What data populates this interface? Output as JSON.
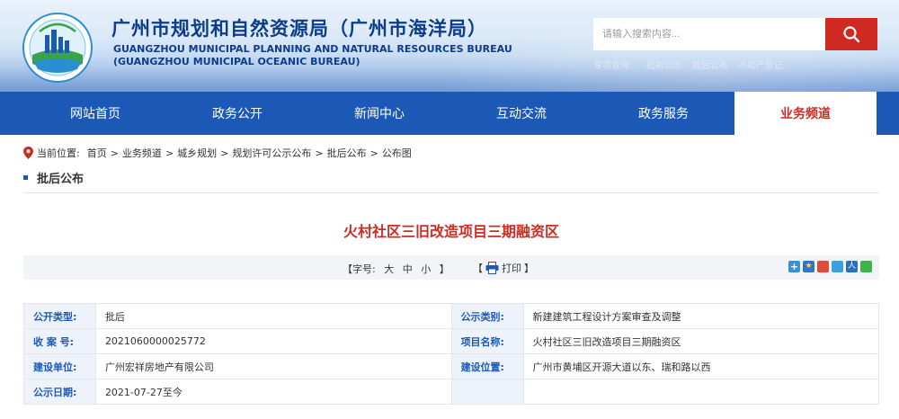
{
  "site": {
    "title_cn": "广州市规划和自然资源局（广州市海洋局）",
    "title_en1": "GUANGZHOU MUNICIPAL PLANNING AND NATURAL RESOURCES BUREAU",
    "title_en2": "(GUANGZHOU MUNICIPAL OCEANIC BUREAU)"
  },
  "search": {
    "placeholder": "请输入搜索内容...",
    "icon": "search-icon"
  },
  "quick_links": {
    "label": "专项查询:",
    "items": [
      "批前公示",
      "批后公布",
      "不动产登记"
    ]
  },
  "nav": {
    "items": [
      {
        "label": "网站首页"
      },
      {
        "label": "政务公开"
      },
      {
        "label": "新闻中心"
      },
      {
        "label": "互动交流"
      },
      {
        "label": "政务服务"
      },
      {
        "label": "业务频道",
        "active": true
      }
    ]
  },
  "breadcrumb": {
    "prefix": "当前位置:",
    "items": [
      "首页",
      "业务频道",
      "城乡规划",
      "规划许可公示公布",
      "批后公布",
      "公布图"
    ],
    "separator": ">"
  },
  "section": {
    "title": "批后公布"
  },
  "article": {
    "title": "火村社区三旧改造项目三期融资区"
  },
  "toolbar": {
    "font_open": "【字号:",
    "font_large": "大",
    "font_medium": "中",
    "font_small": "小",
    "font_close": "】",
    "print_open": "【",
    "print_label": "打印",
    "print_close": "】"
  },
  "info": {
    "rows": [
      {
        "l1": "公开类型:",
        "v1": "批后",
        "l2": "公示类别:",
        "v2": "新建建筑工程设计方案审查及调整"
      },
      {
        "l1": "收 案 号:",
        "v1": "2021060000025772",
        "l2": "项目名称:",
        "v2": "火村社区三旧改造项目三期融资区"
      },
      {
        "l1": "建设单位:",
        "v1": "广州宏祥房地产有限公司",
        "l2": "建设位置:",
        "v2": "广州市黄埔区开源大道以东、瑞和路以西"
      },
      {
        "l1": "公示日期:",
        "v1": "2021-07-27至今",
        "l2": "",
        "v2": ""
      }
    ]
  },
  "colors": {
    "nav_bg": "#1c59b7",
    "accent_red": "#cf2a22",
    "title_blue": "#0d3d8a"
  },
  "share_icons": [
    "plus-icon",
    "star-icon",
    "weibo-icon",
    "qzone-icon",
    "renren-icon",
    "wechat-icon"
  ]
}
